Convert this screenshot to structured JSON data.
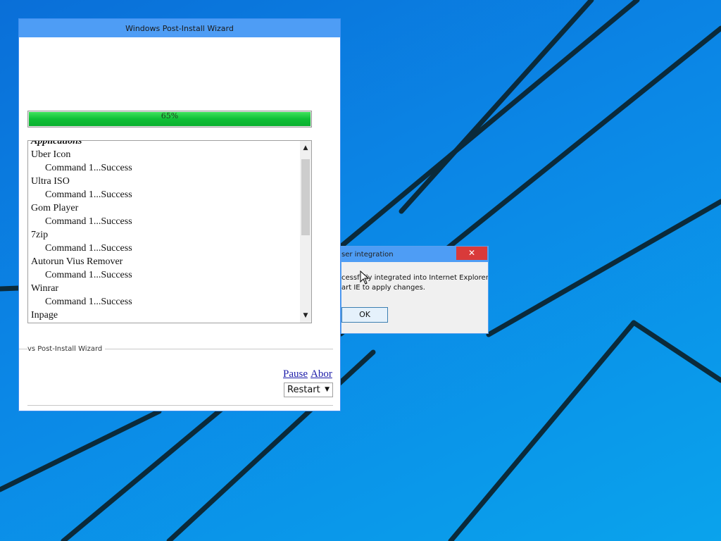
{
  "wizard": {
    "title": "Windows Post-Install Wizard",
    "progress": {
      "value": 0.65,
      "label": "65%"
    },
    "log_lines": [
      {
        "text": "Applications",
        "kind": "heading"
      },
      {
        "text": "Uber Icon",
        "kind": "app"
      },
      {
        "text": "Command 1...Success",
        "kind": "cmd"
      },
      {
        "text": "Ultra ISO",
        "kind": "app"
      },
      {
        "text": "Command 1...Success",
        "kind": "cmd"
      },
      {
        "text": "Gom Player",
        "kind": "app"
      },
      {
        "text": "Command 1...Success",
        "kind": "cmd"
      },
      {
        "text": "7zip",
        "kind": "app"
      },
      {
        "text": "Command 1...Success",
        "kind": "cmd"
      },
      {
        "text": "Autorun Vius Remover",
        "kind": "app"
      },
      {
        "text": "Command 1...Success",
        "kind": "cmd"
      },
      {
        "text": "Winrar",
        "kind": "app"
      },
      {
        "text": "Command 1...Success",
        "kind": "cmd"
      },
      {
        "text": "Inpage",
        "kind": "app"
      }
    ],
    "group_label": "vs Post-Install Wizard",
    "pause_label": "Pause",
    "abort_label": "Abor",
    "restart_select": {
      "selected": "Restart"
    }
  },
  "dialog": {
    "title": "ser integration",
    "close_glyph": "✕",
    "message_line1": "cessfully integrated into Internet Explorer.",
    "message_line2": "art IE to apply changes.",
    "ok_label": "OK"
  },
  "icons": {
    "scroll_up": "▲",
    "scroll_down": "▼",
    "dropdown_caret": "▼"
  }
}
